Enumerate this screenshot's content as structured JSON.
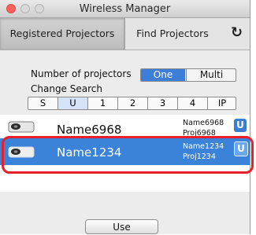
{
  "window": {
    "title": "Wireless Manager"
  },
  "tabs": [
    {
      "label": "Registered Projectors",
      "selected": true
    },
    {
      "label": "Find Projectors",
      "selected": false
    }
  ],
  "toolbar": {
    "refresh_icon": "refresh-icon"
  },
  "search_panel": {
    "count_label": "Number of projectors",
    "count_options": [
      "One",
      "Multi"
    ],
    "count_selected": "One",
    "change_label": "Change Search",
    "search_options": [
      "S",
      "U",
      "1",
      "2",
      "3",
      "4",
      "IP"
    ],
    "search_selected": "U"
  },
  "projectors": [
    {
      "name": "Name6968",
      "meta_name": "Name6968",
      "meta_proj": "Proj6968",
      "button": "U",
      "selected": false,
      "icon": "projector-icon"
    },
    {
      "name": "Name1234",
      "meta_name": "Name1234",
      "meta_proj": "Proj1234",
      "button": "U",
      "selected": true,
      "icon": "projector-icon"
    }
  ],
  "use_button": "Use",
  "colors": {
    "accent": "#3a83d8",
    "highlight": "#e8202a"
  }
}
